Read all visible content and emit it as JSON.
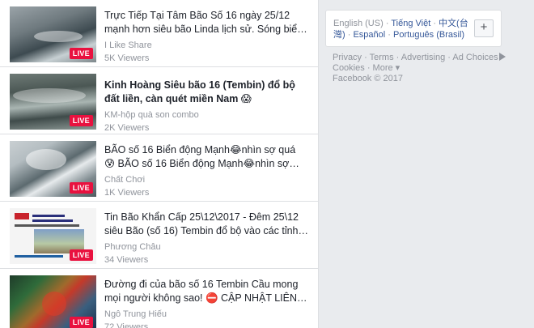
{
  "videos": [
    {
      "title": "Trực Tiếp Tại Tâm Bão Số 16 ngày 25/12 mạnh hơn siêu bão Linda lịch sử. Sóng biển đánh cao...",
      "title_bold": false,
      "author": "I Like Share",
      "viewers": "5K Viewers",
      "badge": "LIVE"
    },
    {
      "title": "Kinh Hoàng Siêu bão 16 (Tembin) đổ bộ đất liền, càn quét miền Nam 😱",
      "title_bold": true,
      "author": "KM-hộp quà son combo",
      "viewers": "2K Viewers",
      "badge": "LIVE"
    },
    {
      "title": "BÃO số 16 Biển động Mạnh😂nhìn sợ quá 😰 BÃO số 16 Biển động Mạnh😂nhìn sợ quá 😰 T...",
      "title_bold": false,
      "author": "Chất Chơi",
      "viewers": "1K Viewers",
      "badge": "LIVE"
    },
    {
      "title": "Tin Bão Khẩn Cấp 25\\12\\2017 - Đêm 25\\12 siêu Bão (số 16) Tembin đổ bộ vào các tỉnh Nam Bộ",
      "title_bold": false,
      "author": "Phương Châu",
      "viewers": "34 Viewers",
      "badge": "LIVE"
    },
    {
      "title": "Đường đi của bão số 16 Tembin Cầu mong mọi người không sao! ⛔ CẬP NHẬT LIÊN TỤC...",
      "title_bold": false,
      "author": "Ngô Trung Hiếu",
      "viewers": "72 Viewers",
      "badge": "LIVE"
    }
  ],
  "languages": {
    "current": "English (US)",
    "others": [
      "Tiếng Việt",
      "中文(台灣)",
      "Español",
      "Português (Brasil)"
    ],
    "add_label": "+"
  },
  "footer": {
    "links": [
      "Privacy",
      "Terms",
      "Advertising",
      "Ad Choices",
      "Cookies",
      "More"
    ],
    "copyright": "Facebook © 2017"
  }
}
